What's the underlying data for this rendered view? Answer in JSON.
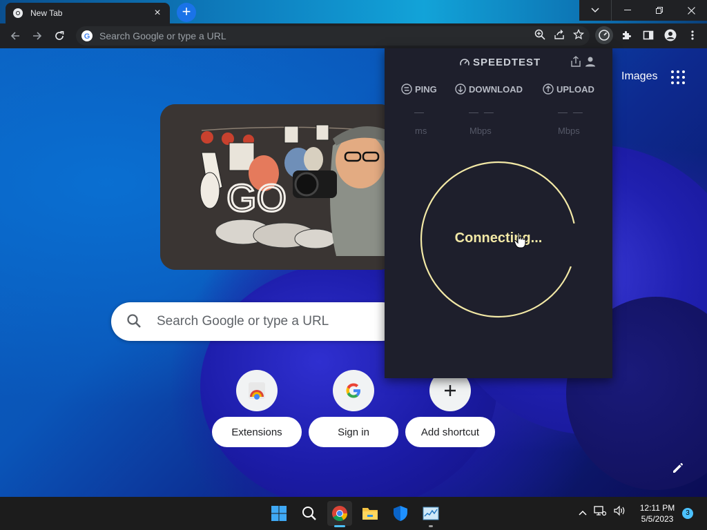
{
  "browser": {
    "tab_title": "New Tab",
    "omnibox_placeholder": "Search Google or type a URL"
  },
  "ntp": {
    "images_link": "Images",
    "search_placeholder": "Search Google or type a URL",
    "doodle_text": "GO",
    "shortcuts": [
      {
        "label": "Extensions",
        "icon": "chrome-icon"
      },
      {
        "label": "Sign in",
        "icon": "google-icon"
      },
      {
        "label": "Add shortcut",
        "icon": "plus-icon"
      }
    ]
  },
  "speedtest": {
    "brand": "SPEEDTEST",
    "metrics": [
      {
        "label": "PING",
        "value": "—",
        "unit": "ms"
      },
      {
        "label": "DOWNLOAD",
        "value": "— —",
        "unit": "Mbps"
      },
      {
        "label": "UPLOAD",
        "value": "— —",
        "unit": "Mbps"
      }
    ],
    "status": "Connecting...",
    "ring_color": "#f3e9a6",
    "background": "#1e1f2c"
  },
  "taskbar": {
    "time": "12:11 PM",
    "date": "5/5/2023",
    "notifications": "3"
  },
  "colors": {
    "chrome_dark": "#202124",
    "accent_blue": "#1a73e8",
    "taskbar_accent": "#4cc2ff"
  }
}
